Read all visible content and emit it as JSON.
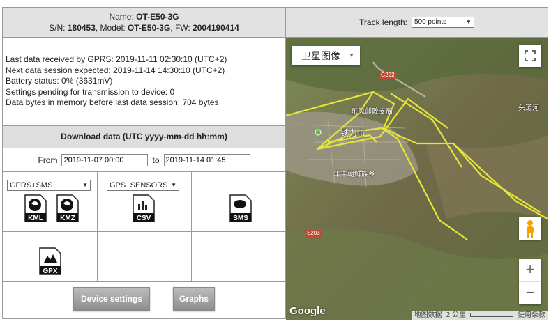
{
  "device": {
    "name_label": "Name:",
    "name": "OT-E50-3G",
    "sn_label": "S/N:",
    "sn": "180453",
    "model_label": ", Model:",
    "model": "OT-E50-3G",
    "fw_label": ", FW:",
    "fw": "2004190414"
  },
  "info": {
    "lines": [
      "Last data received by GPRS: 2019-11-11 02:30:10 (UTC+2)",
      "Next data session expected: 2019-11-14 14:30:10 (UTC+2)",
      "Battery status: 0% (3631mV)",
      "Settings pending for transmission to device: 0",
      "Data bytes in memory before last data session: 704 bytes"
    ]
  },
  "download": {
    "header": "Download data (UTC yyyy-mm-dd hh:mm)",
    "from_label": "From",
    "from_value": "2019-11-07 00:00",
    "to_label": "to",
    "to_value": "2019-11-14 01:45",
    "select1": "GPRS+SMS",
    "select2": "GPS+SENSORS",
    "files": {
      "kml": "KML",
      "kmz": "KMZ",
      "csv": "CSV",
      "sms": "SMS",
      "gpx": "GPX"
    }
  },
  "buttons": {
    "settings": "Device settings",
    "graphs": "Graphs"
  },
  "track": {
    "label": "Track length:",
    "value": "500 points"
  },
  "map": {
    "maptype": "卫星图像",
    "logo": "Google",
    "attr_data": "地图数据",
    "attr_scale": "2 公里",
    "attr_terms": "使用条款",
    "labels": {
      "city": "铁力市",
      "post": "东风邮政支局",
      "farm": "年丰朝鲜族乡",
      "road1": "G222",
      "road2": "S203",
      "town": "头道河"
    }
  },
  "colors": {
    "track": "#e6e63a",
    "header_bg": "#e2e2e2",
    "button": "#a3a3a3"
  },
  "icons": [
    "file-kml-icon",
    "file-kmz-icon",
    "file-csv-icon",
    "file-sms-icon",
    "file-gpx-icon",
    "fullscreen-icon",
    "pegman-icon"
  ]
}
